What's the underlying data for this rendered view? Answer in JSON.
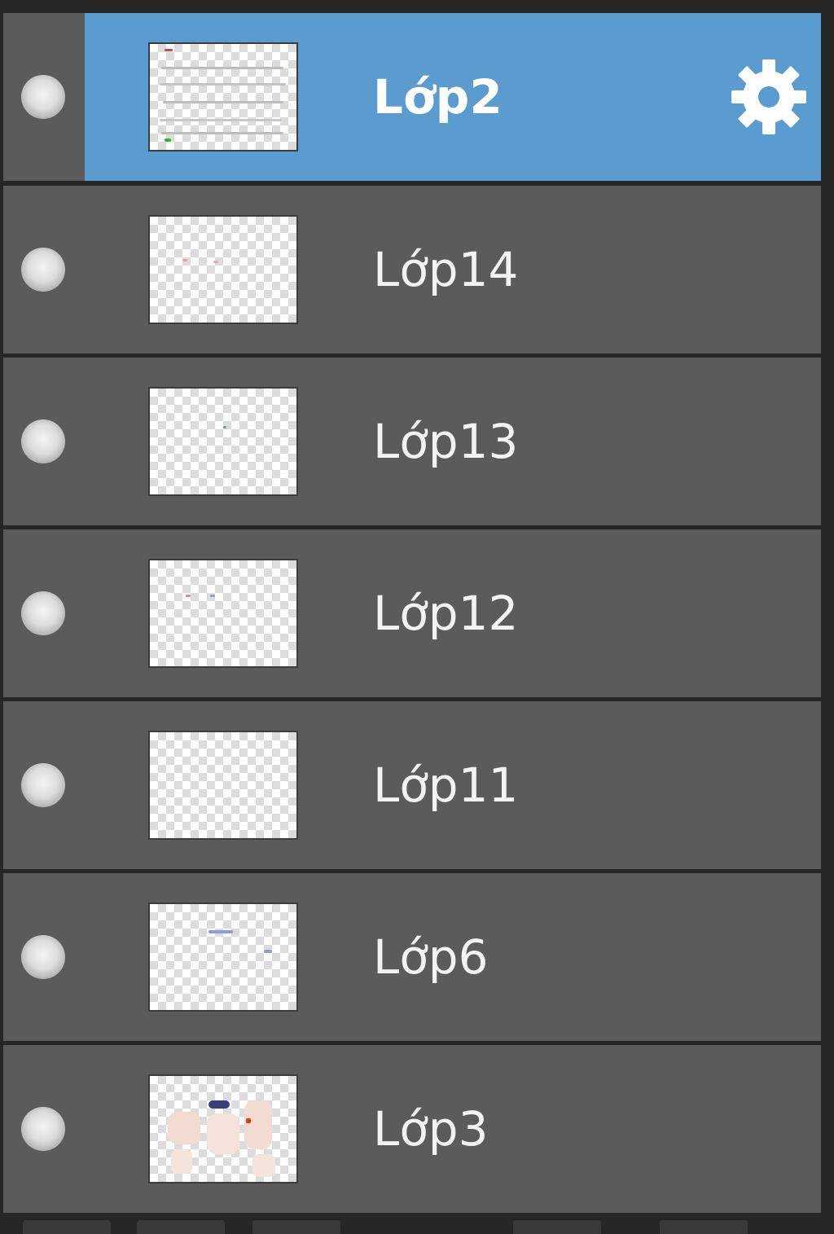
{
  "layers_panel": {
    "layers": [
      {
        "name": "Lớp2",
        "selected": true
      },
      {
        "name": "Lớp14",
        "selected": false
      },
      {
        "name": "Lớp13",
        "selected": false
      },
      {
        "name": "Lớp12",
        "selected": false
      },
      {
        "name": "Lớp11",
        "selected": false
      },
      {
        "name": "Lớp6",
        "selected": false
      },
      {
        "name": "Lớp3",
        "selected": false
      }
    ],
    "icons": {
      "visibility": "visibility-dot-icon",
      "settings": "gear-icon"
    },
    "colors": {
      "selected_row": "#5a9bd0",
      "row": "#5b5b5b",
      "background": "#262626",
      "text": "#f2f2f2"
    }
  }
}
